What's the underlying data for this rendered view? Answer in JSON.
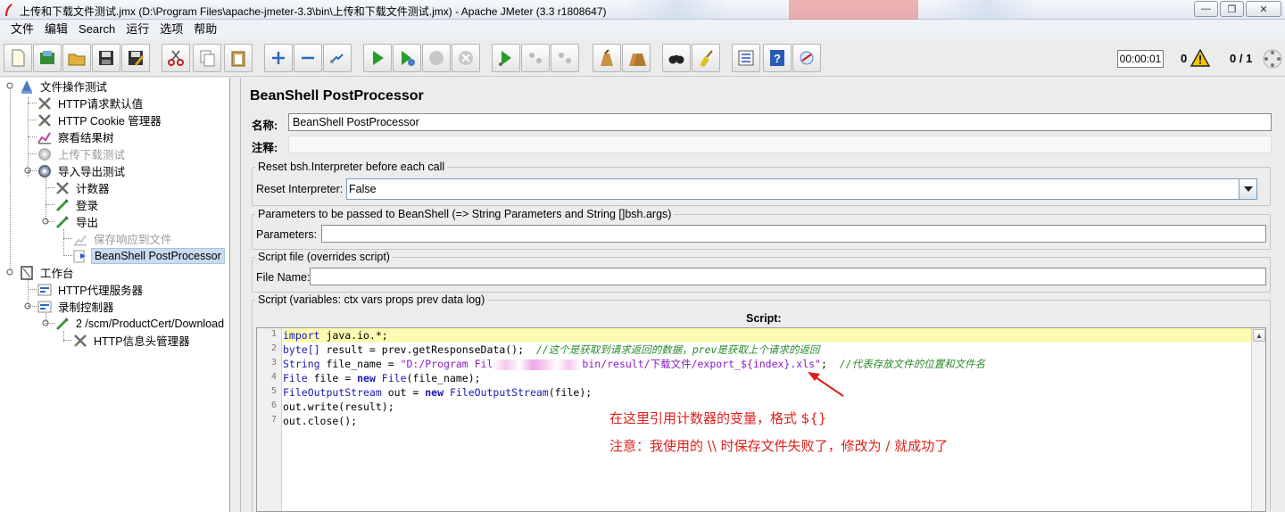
{
  "window": {
    "title": "上传和下载文件测试.jmx (D:\\Program Files\\apache-jmeter-3.3\\bin\\上传和下载文件测试.jmx) - Apache JMeter (3.3 r1808647)",
    "minimize": "—",
    "maximize": "❐",
    "close": "✕"
  },
  "menu": [
    "文件",
    "编辑",
    "Search",
    "运行",
    "选项",
    "帮助"
  ],
  "toolbar_icons": [
    "new-icon",
    "templates-icon",
    "open-icon",
    "save-icon",
    "save-as-icon",
    "cut-icon",
    "copy-icon",
    "paste-icon",
    "expand-icon",
    "collapse-icon",
    "toggle-icon",
    "start-icon",
    "start-no-pause-icon",
    "stop-icon",
    "shutdown-icon",
    "remote-start-icon",
    "remote-stop-icon",
    "remote-shutdown-icon",
    "clear-icon",
    "clear-all-icon",
    "search-icon",
    "reset-search-icon",
    "function-helper-icon",
    "help-icon",
    "log-icon"
  ],
  "status": {
    "timer": "00:00:01",
    "error_count": "0",
    "threads": "0 / 1"
  },
  "tree": [
    {
      "label": "文件操作测试",
      "icon": "test-plan-icon",
      "disabled": false,
      "selected": false
    },
    {
      "label": "HTTP请求默认值",
      "icon": "config-element-icon",
      "disabled": false,
      "selected": false
    },
    {
      "label": "HTTP Cookie 管理器",
      "icon": "config-element-icon",
      "disabled": false,
      "selected": false
    },
    {
      "label": "察看结果树",
      "icon": "listener-icon",
      "disabled": false,
      "selected": false
    },
    {
      "label": "上传下载测试",
      "icon": "thread-group-icon",
      "disabled": true,
      "selected": false
    },
    {
      "label": "导入导出测试",
      "icon": "thread-group-icon",
      "disabled": false,
      "selected": false
    },
    {
      "label": "计数器",
      "icon": "config-element-icon",
      "disabled": false,
      "selected": false
    },
    {
      "label": "登录",
      "icon": "sampler-icon",
      "disabled": false,
      "selected": false
    },
    {
      "label": "导出",
      "icon": "sampler-icon",
      "disabled": false,
      "selected": false
    },
    {
      "label": "保存响应到文件",
      "icon": "listener-icon",
      "disabled": true,
      "selected": false
    },
    {
      "label": "BeanShell PostProcessor",
      "icon": "post-processor-icon",
      "disabled": false,
      "selected": true
    },
    {
      "label": "工作台",
      "icon": "workbench-icon",
      "disabled": false,
      "selected": false
    },
    {
      "label": "HTTP代理服务器",
      "icon": "proxy-icon",
      "disabled": false,
      "selected": false
    },
    {
      "label": "录制控制器",
      "icon": "controller-icon",
      "disabled": false,
      "selected": false
    },
    {
      "label": "2 /scm/ProductCert/Download",
      "icon": "sampler-icon",
      "disabled": false,
      "selected": false
    },
    {
      "label": "HTTP信息头管理器",
      "icon": "config-element-icon",
      "disabled": false,
      "selected": false
    }
  ],
  "panel": {
    "title": "BeanShell PostProcessor",
    "name_label": "名称:",
    "name_value": "BeanShell PostProcessor",
    "comment_label": "注释:",
    "comment_value": "",
    "reset_group_title": "Reset bsh.Interpreter before each call",
    "reset_label": "Reset Interpreter:",
    "reset_value": "False",
    "params_group_title": "Parameters to be passed to BeanShell (=> String Parameters and String []bsh.args)",
    "params_label": "Parameters:",
    "params_value": "",
    "scriptfile_group_title": "Script file (overrides script)",
    "filename_label": "File Name:",
    "filename_value": "",
    "script_group_title": "Script (variables: ctx vars props prev data log)",
    "script_label": "Script:"
  },
  "code": {
    "line_numbers": [
      "1",
      "2",
      "3",
      "4",
      "5",
      "6",
      "7"
    ],
    "l1_kw": "import",
    "l1_rest": " java.io.*;",
    "l2_type": "byte[]",
    "l2_rest": " result = prev.getResponseData();  ",
    "l2_comment": "//这个是获取到请求返回的数据，prev是获取上个请求的返回",
    "l3_type": "String",
    "l3_rest": " file_name = ",
    "l3_str_a": "\"D:/Program Fil",
    "l3_str_b": "bin/result/下载文件/export_${index}.xls\"",
    "l3_rest2": ";  ",
    "l3_comment": "//代表存放文件的位置和文件名",
    "l4_type": "File",
    "l4_rest": " file = ",
    "l4_kw": "new",
    "l4_type2": " File",
    "l4_rest2": "(file_name);",
    "l5_type": "FileOutputStream",
    "l5_rest": " out = ",
    "l5_kw": "new",
    "l5_type2": " FileOutputStream",
    "l5_rest2": "(file);",
    "l6": "out.write(result);",
    "l7": "out.close();"
  },
  "annotations": {
    "line1": "在这里引用计数器的变量，格式 ${}",
    "line2": "注意：我使用的 \\\\ 时保存文件失败了，修改为 / 就成功了",
    "color": "#e0201a"
  }
}
